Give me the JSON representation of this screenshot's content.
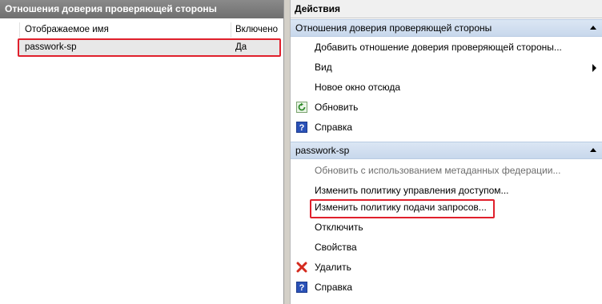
{
  "left_pane": {
    "title": "Отношения доверия проверяющей стороны",
    "columns": {
      "name": "Отображаемое имя",
      "enabled": "Включено"
    },
    "rows": [
      {
        "name": "passwork-sp",
        "enabled": "Да"
      }
    ]
  },
  "actions": {
    "title": "Действия",
    "section1": {
      "header": "Отношения доверия проверяющей стороны",
      "items": [
        {
          "label": "Добавить отношение доверия проверяющей стороны..."
        },
        {
          "label": "Вид"
        },
        {
          "label": "Новое окно отсюда"
        },
        {
          "label": "Обновить",
          "icon": "refresh-icon"
        },
        {
          "label": "Справка",
          "icon": "help-icon"
        }
      ]
    },
    "section2": {
      "header": "passwork-sp",
      "items": [
        {
          "label": "Обновить с использованием метаданных федерации..."
        },
        {
          "label": "Изменить политику управления доступом..."
        },
        {
          "label": "Изменить политику подачи запросов..."
        },
        {
          "label": "Отключить"
        },
        {
          "label": "Свойства"
        },
        {
          "label": "Удалить",
          "icon": "delete-icon"
        },
        {
          "label": "Справка",
          "icon": "help-icon"
        }
      ]
    }
  },
  "colors": {
    "highlight": "#e0202c",
    "section_header": "#c8d8ec",
    "left_header": "#7a7a7a"
  }
}
